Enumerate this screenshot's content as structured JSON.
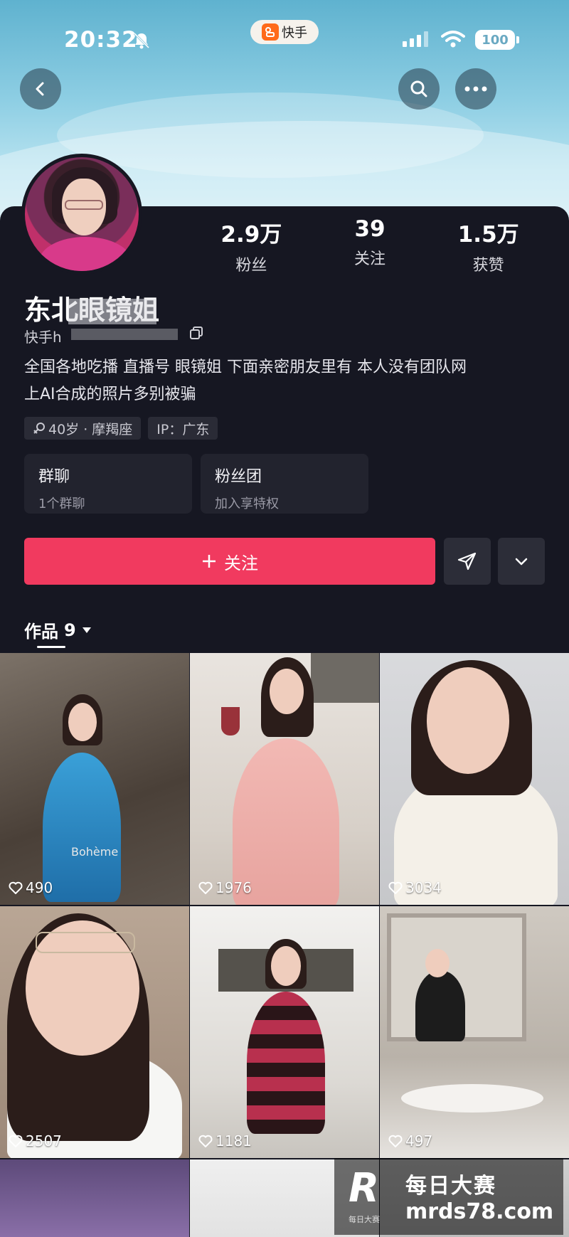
{
  "status_bar": {
    "time": "20:32",
    "app_name": "快手",
    "battery": "100"
  },
  "profile": {
    "stats": [
      {
        "value": "2.9万",
        "label": "粉丝"
      },
      {
        "value": "39",
        "label": "关注"
      },
      {
        "value": "1.5万",
        "label": "获赞"
      }
    ],
    "name": "东北眼镜姐",
    "user_id_prefix": "快手h",
    "bio_line1": "全国各地吃播 直播号 眼镜姐 下面亲密朋友里有 本人没有团队网",
    "bio_line2": "上AI合成的照片多别被骗",
    "tags": [
      {
        "text": "40岁 · 摩羯座",
        "icon": "gender-female-icon"
      },
      {
        "text": "IP：广东"
      }
    ],
    "tiles": [
      {
        "title": "群聊",
        "subtitle": "1个群聊"
      },
      {
        "title": "粉丝团",
        "subtitle": "加入享特权"
      }
    ],
    "follow_label": "关注"
  },
  "works": {
    "tab_label": "作品",
    "count": "9",
    "items": [
      {
        "likes": "490",
        "caption": "Bohème"
      },
      {
        "likes": "1976"
      },
      {
        "likes": "3034"
      },
      {
        "likes": "2507"
      },
      {
        "likes": "1181"
      },
      {
        "likes": "497"
      },
      {},
      {},
      {}
    ]
  },
  "watermark": {
    "logo_letter": "R",
    "small_text": "每日大赛",
    "title": "每日大赛",
    "url": "mrds78.com"
  },
  "colors": {
    "accent": "#f13a5f",
    "background": "#161722",
    "hero_sky": "#8fcfe4"
  }
}
